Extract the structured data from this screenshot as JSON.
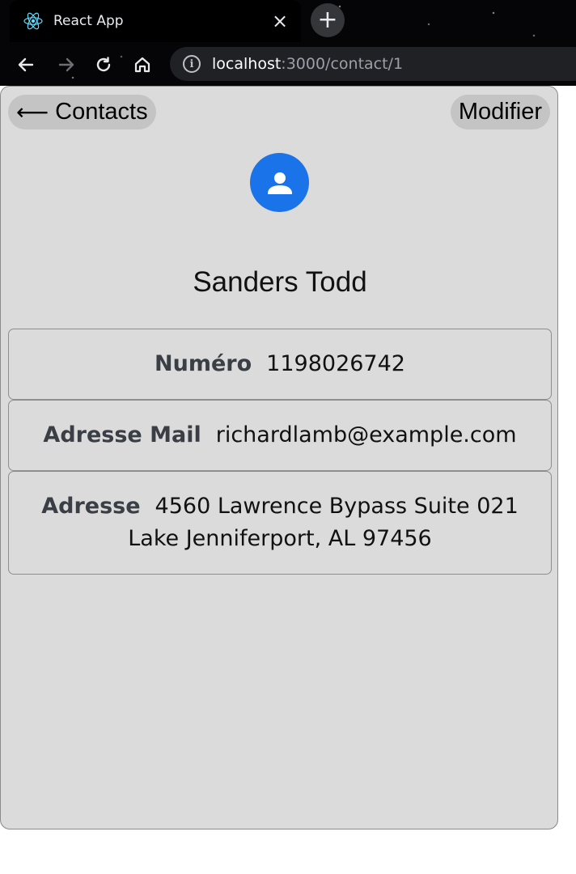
{
  "browser": {
    "tab_title": "React App",
    "close_glyph": "×",
    "new_tab_glyph": "+",
    "url_host": "localhost",
    "url_path": ":3000/contact/1",
    "info_glyph": "i",
    "icons": [
      "react-favicon",
      "back-arrow",
      "forward-arrow",
      "reload",
      "home",
      "info"
    ]
  },
  "header": {
    "back_arrow": "⟵",
    "back_label": "Contacts",
    "edit_label": "Modifier"
  },
  "contact": {
    "name": "Sanders Todd",
    "avatar_color": "#1a73e8",
    "fields": {
      "phone_label": "Numéro",
      "phone_value": "1198026742",
      "email_label": "Adresse Mail",
      "email_value": "richardlamb@example.com",
      "address_label": "Adresse",
      "address_line1": "4560 Lawrence Bypass Suite 021",
      "address_line2": "Lake Jenniferport, AL 97456"
    }
  },
  "colors": {
    "card_background": "#dbdbdb",
    "button_background": "#c4c4c4",
    "browser_dark": "#050508"
  }
}
